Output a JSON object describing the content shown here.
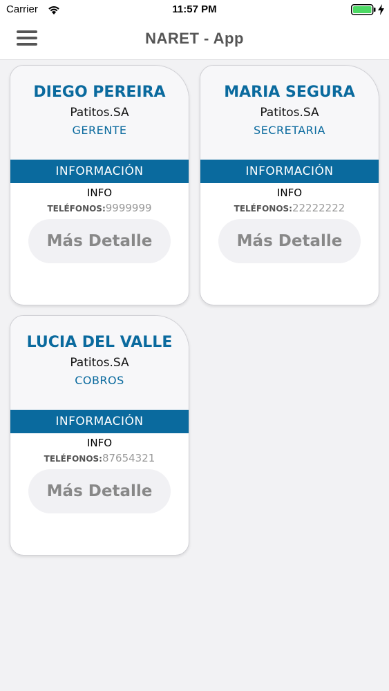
{
  "status": {
    "carrier": "Carrier",
    "time": "11:57 PM"
  },
  "nav": {
    "title": "NARET - App"
  },
  "cards": [
    {
      "name": "DIEGO PEREIRA",
      "company": "Patitos.SA",
      "role": "GERENTE",
      "section": "INFORMACIÓN",
      "info_label": "INFO",
      "phone_label": "TELÉFONOS:",
      "phone": "9999999",
      "button": "Más Detalle"
    },
    {
      "name": "MARIA SEGURA",
      "company": "Patitos.SA",
      "role": "SECRETARIA",
      "section": "INFORMACIÓN",
      "info_label": "INFO",
      "phone_label": "TELÉFONOS:",
      "phone": "22222222",
      "button": "Más Detalle"
    },
    {
      "name": "LUCIA DEL VALLE",
      "company": "Patitos.SA",
      "role": "COBROS",
      "section": "INFORMACIÓN",
      "info_label": "INFO",
      "phone_label": "TELÉFONOS:",
      "phone": "87654321",
      "button": "Más Detalle"
    }
  ],
  "colors": {
    "accent": "#0a6a9e",
    "battery": "#4cd964"
  }
}
